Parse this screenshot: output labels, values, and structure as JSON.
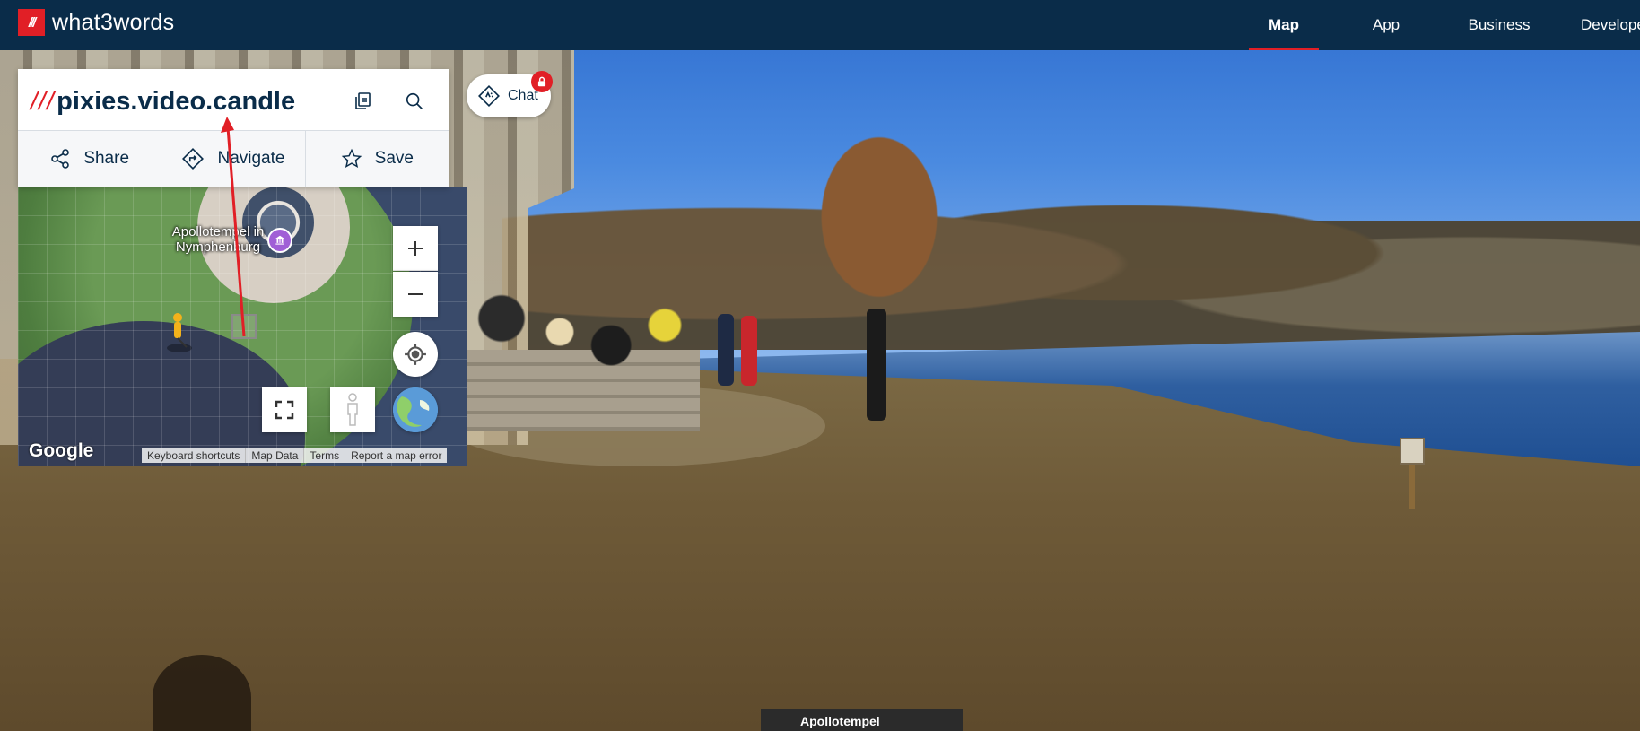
{
  "topbar": {
    "logo_mark": "///",
    "logo_text": "what3words",
    "nav": [
      {
        "label": "Map",
        "active": true
      },
      {
        "label": "App"
      },
      {
        "label": "Business"
      },
      {
        "label": "Develope"
      }
    ],
    "accent_color": "#e11f26",
    "bg_color": "#0a2c49"
  },
  "address_card": {
    "slashes": "///",
    "words": "pixies.video.candle",
    "copy_icon": "copy-icon",
    "search_icon": "search-icon",
    "actions": [
      {
        "label": "Share",
        "icon": "share-icon"
      },
      {
        "label": "Navigate",
        "icon": "navigate-icon"
      },
      {
        "label": "Save",
        "icon": "star-icon"
      }
    ]
  },
  "chat": {
    "label": "Chat",
    "icon": "chat-sparkle-icon",
    "badge_icon": "lock-icon"
  },
  "minimap": {
    "place_label": "Apollotempel in Nymphenburg",
    "zoom_in": "+",
    "zoom_out": "−",
    "logo": "Google",
    "footer_links": [
      "Keyboard shortcuts",
      "Map Data",
      "Terms",
      "Report a map error"
    ]
  },
  "street_view": {
    "place_tag": "Apollotempel"
  }
}
